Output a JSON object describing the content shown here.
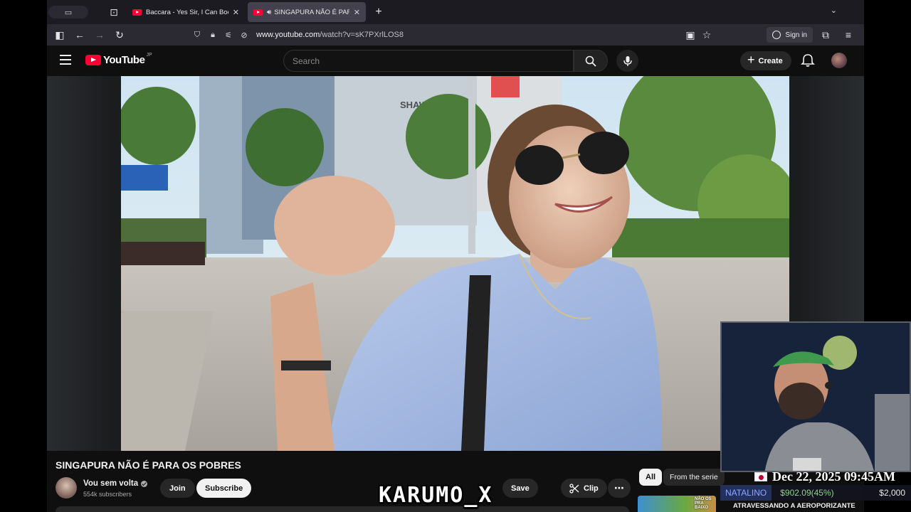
{
  "browser": {
    "tabs": [
      {
        "title": "Baccara - Yes Sir, I Can Boogie",
        "active": false
      },
      {
        "title": "SINGAPURA NÃO É PARA O",
        "active": true
      }
    ],
    "url_domain": "www.youtube.com",
    "url_path": "/watch?v=sK7PXrlLOS8",
    "sign_in_label": "Sign in"
  },
  "youtube": {
    "logo_text": "YouTube",
    "region": "JP",
    "search_placeholder": "Search",
    "create_label": "Create"
  },
  "video": {
    "title": "SINGAPURA NÃO É PARA OS POBRES",
    "channel_name": "Vou sem volta",
    "subscribers": "554k subscribers",
    "join_label": "Join",
    "subscribe_label": "Subscribe",
    "save_label": "Save",
    "clip_label": "Clip",
    "scene_sign_text": "SHAW"
  },
  "sidebar": {
    "chips": [
      "All",
      "From the serie"
    ],
    "thumb_text": "NÃO OS PRA BAIXO",
    "rec_title": "ATRAVESSANDO A AEROPORIZANTE"
  },
  "overlay": {
    "watermark": "KARUMO_X",
    "date_time": "Dec 22, 2025 09:45AM",
    "ticker_name": "NATALINO",
    "ticker_value": "$902.09(45%)",
    "ticker_goal": "$2,000"
  },
  "colors": {
    "brand_red": "#ff0033",
    "bg": "#0f0f0f",
    "chip_bg": "#272727"
  }
}
